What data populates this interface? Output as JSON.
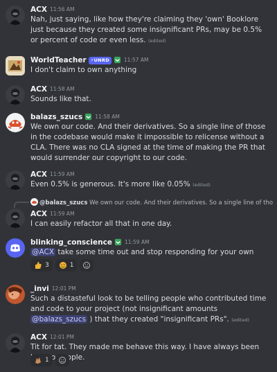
{
  "messages": [
    {
      "user": "ACX",
      "time": "11:56 AM",
      "text": "Nah, just saying, like how they're claiming they 'own' Booklore just because they created some insignificant PRs, may be 0.5% or percent of code or even less.",
      "edited": "(edited)"
    },
    {
      "user": "WorldTeacher",
      "tag": "UNRD",
      "time": "11:57 AM",
      "text": "I don't claim to own anything"
    },
    {
      "user": "ACX",
      "time": "11:58 AM",
      "text": "Sounds like that."
    },
    {
      "user": "balazs_szucs",
      "time": "11:58 AM",
      "text": "We own our code. And their derivatives. So a single line of those in the codebase would make it impossible to relicense without a CLA. There was no CLA signed at the time of making the PR that would surrender our copyright to our code."
    },
    {
      "user": "ACX",
      "time": "11:59 AM",
      "text": "Even 0.5% is generous. It's more like 0.05%",
      "edited": "(edited)"
    },
    {
      "reply_to_user": "@balazs_szucs",
      "reply_snippet": "We own our code. And their derivatives. So a single line of those in th...",
      "user": "ACX",
      "time": "11:59 AM",
      "text": "I can easily refactor all that in one day."
    },
    {
      "user": "blinking_conscience",
      "time": "11:59 AM",
      "mention": "@ACX",
      "text": "take some time out and stop responding for your own sake",
      "reactions": [
        {
          "emoji": "thumbs-up-icon",
          "count": "3"
        },
        {
          "emoji": "yellow-face-icon",
          "count": "1"
        }
      ]
    },
    {
      "user": "_invi",
      "time": "12:01 PM",
      "text_before": "Such a distasteful look to be telling people who contributed time and code to your project (not insignificant amounts",
      "mention": "@balazs_szucs",
      "text_after": ") that they created \"insignificant PRs\".",
      "edited": "(edited)"
    },
    {
      "user": "ACX",
      "time": "12:01 PM",
      "text": "Tit for tat. They made me behave this way. I have always been kind to people.",
      "reactions": [
        {
          "emoji": "hands-icon",
          "count": "1"
        }
      ]
    }
  ],
  "colors": {
    "bg": "#313338",
    "mention": "#5865f2",
    "muted": "#949ba4"
  }
}
